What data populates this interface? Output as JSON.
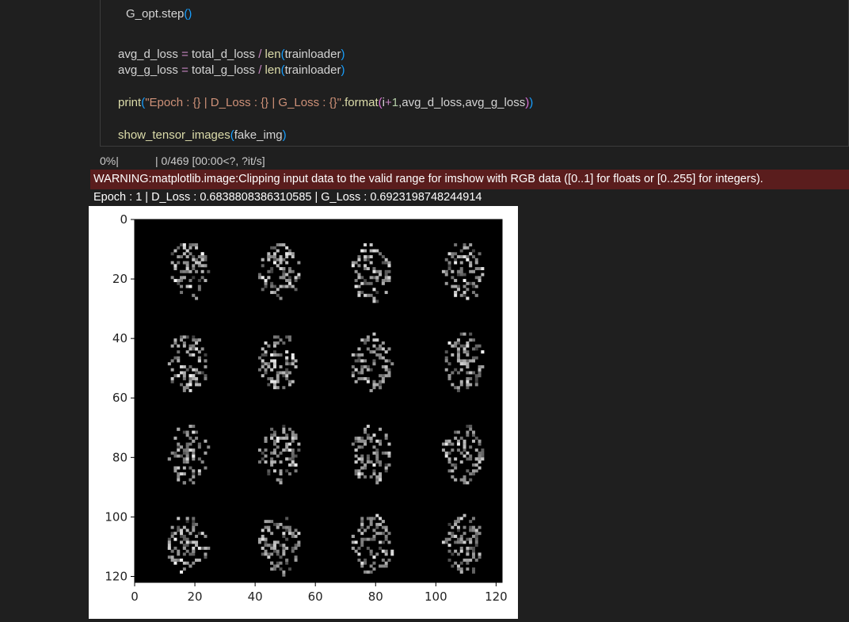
{
  "code_lines": [
    {
      "indent": 1,
      "tokens": [
        {
          "t": "G_opt.step",
          "c": "var"
        },
        {
          "t": "()",
          "c": "paren"
        }
      ]
    },
    {
      "indent": 0,
      "tokens": []
    },
    {
      "indent": 0,
      "tokens": [
        {
          "t": "avg_d_loss ",
          "c": "var"
        },
        {
          "t": "=",
          "c": "kw"
        },
        {
          "t": " total_d_loss ",
          "c": "var"
        },
        {
          "t": "/",
          "c": "kw"
        },
        {
          "t": " len",
          "c": "fn"
        },
        {
          "t": "(",
          "c": "paren"
        },
        {
          "t": "trainloader",
          "c": "var"
        },
        {
          "t": ")",
          "c": "paren"
        }
      ]
    },
    {
      "indent": 0,
      "tokens": [
        {
          "t": "avg_g_loss ",
          "c": "var"
        },
        {
          "t": "=",
          "c": "kw"
        },
        {
          "t": " total_g_loss ",
          "c": "var"
        },
        {
          "t": "/",
          "c": "kw"
        },
        {
          "t": " len",
          "c": "fn"
        },
        {
          "t": "(",
          "c": "paren"
        },
        {
          "t": "trainloader",
          "c": "var"
        },
        {
          "t": ")",
          "c": "paren"
        }
      ]
    },
    {
      "indent": 0,
      "tokens": []
    },
    {
      "indent": 0,
      "tokens": [
        {
          "t": "print",
          "c": "fn"
        },
        {
          "t": "(",
          "c": "paren"
        },
        {
          "t": "\"Epoch : {} | D_Loss : {} | G_Loss : {}\"",
          "c": "str"
        },
        {
          "t": ".format",
          "c": "fn"
        },
        {
          "t": "(",
          "c": "paren2"
        },
        {
          "t": "i",
          "c": "var"
        },
        {
          "t": "+",
          "c": "plus"
        },
        {
          "t": "1",
          "c": "num"
        },
        {
          "t": ",avg_d_loss,avg_g_loss",
          "c": "var"
        },
        {
          "t": ")",
          "c": "paren2"
        },
        {
          "t": ")",
          "c": "paren"
        }
      ]
    },
    {
      "indent": 0,
      "tokens": []
    },
    {
      "indent": 0,
      "tokens": [
        {
          "t": "show_tensor_images",
          "c": "fn"
        },
        {
          "t": "(",
          "c": "paren"
        },
        {
          "t": "fake_img",
          "c": "var"
        },
        {
          "t": ")",
          "c": "paren"
        }
      ]
    }
  ],
  "output": {
    "progress_pct": "0%|",
    "progress_rest": "| 0/469 [00:00<?, ?it/s]",
    "warning": "WARNING:matplotlib.image:Clipping input data to the valid range for imshow with RGB data ([0..1] for floats or [0..255] for integers).",
    "stdout": "Epoch : 1 | D_Loss : 0.6838808386310585 | G_Loss : 0.6923198748244914"
  },
  "chart_data": {
    "type": "image",
    "xticks": [
      "0",
      "20",
      "40",
      "60",
      "80",
      "100",
      "120"
    ],
    "yticks": [
      "0",
      "20",
      "40",
      "60",
      "80",
      "100",
      "120"
    ],
    "xlim": [
      0,
      122
    ],
    "ylim": [
      122,
      0
    ],
    "grid_rows": 4,
    "grid_cols": 4
  }
}
